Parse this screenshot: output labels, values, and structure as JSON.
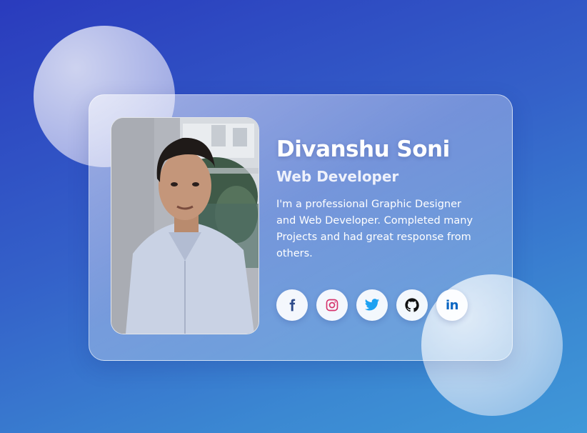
{
  "profile": {
    "name": "Divanshu Soni",
    "role": "Web Developer",
    "bio": "I'm a professional Graphic Designer and Web Developer. Completed many Projects and had great response from others."
  },
  "social_links": [
    {
      "icon": "facebook-icon",
      "color": "#2d4a8a"
    },
    {
      "icon": "instagram-icon",
      "color": "#d6336c"
    },
    {
      "icon": "twitter-icon",
      "color": "#1da1f2"
    },
    {
      "icon": "github-icon",
      "color": "#111111"
    },
    {
      "icon": "linkedin-icon",
      "label": "in",
      "color": "#0a66c2"
    }
  ],
  "colors": {
    "background_start": "#2a3bbd",
    "background_end": "#3f98d8",
    "text": "#ffffff"
  }
}
